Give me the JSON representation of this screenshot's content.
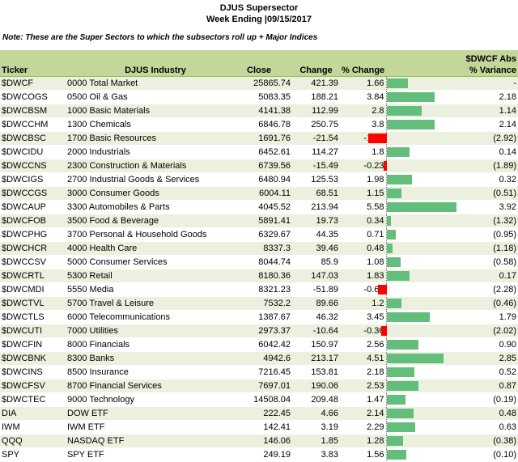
{
  "title": "DJUS Supersector",
  "subtitle": "Week Ending |09/15/2017",
  "note": "Note:  These are the Super Sectors to which the subsectors roll up + Major Indices",
  "headers": {
    "ticker": "Ticker",
    "industry": "DJUS Industry",
    "close": "Close",
    "change": "Change",
    "pct_change": "% Change",
    "abs_line1": "$DWCF Abs",
    "abs_line2": "% Variance"
  },
  "colors": {
    "positive_bar": "#63be7b",
    "negative_bar": "#ff0000",
    "header_bg": "#c4d79b",
    "band_bg": "#ebf1de"
  },
  "bar_scale_max": 5.58,
  "rows": [
    {
      "ticker": "$DWCF",
      "industry": "0000 Total Market",
      "close": "25865.74",
      "change": "421.39",
      "pct": "1.66",
      "pct_val": 1.66,
      "var": "-"
    },
    {
      "ticker": "$DWCOGS",
      "industry": "0500 Oil & Gas",
      "close": "5083.35",
      "change": "188.21",
      "pct": "3.84",
      "pct_val": 3.84,
      "var": "2.18"
    },
    {
      "ticker": "$DWCBSM",
      "industry": "1000 Basic Materials",
      "close": "4141.38",
      "change": "112.99",
      "pct": "2.8",
      "pct_val": 2.8,
      "var": "1.14"
    },
    {
      "ticker": "$DWCCHM",
      "industry": "1300 Chemicals",
      "close": "6846.78",
      "change": "250.75",
      "pct": "3.8",
      "pct_val": 3.8,
      "var": "2.14"
    },
    {
      "ticker": "$DWCBSC",
      "industry": "1700 Basic Resources",
      "close": "1691.76",
      "change": "-21.54",
      "pct": "-1.26",
      "pct_val": -1.26,
      "var": "(2.92)"
    },
    {
      "ticker": "$DWCIDU",
      "industry": "2000 Industrials",
      "close": "6452.61",
      "change": "114.27",
      "pct": "1.8",
      "pct_val": 1.8,
      "var": "0.14"
    },
    {
      "ticker": "$DWCCNS",
      "industry": "2300 Construction & Materials",
      "close": "6739.56",
      "change": "-15.49",
      "pct": "-0.23",
      "pct_val": -0.23,
      "var": "(1.89)"
    },
    {
      "ticker": "$DWCIGS",
      "industry": "2700 Industrial Goods & Services",
      "close": "6480.94",
      "change": "125.53",
      "pct": "1.98",
      "pct_val": 1.98,
      "var": "0.32"
    },
    {
      "ticker": "$DWCCGS",
      "industry": "3000 Consumer Goods",
      "close": "6004.11",
      "change": "68.51",
      "pct": "1.15",
      "pct_val": 1.15,
      "var": "(0.51)"
    },
    {
      "ticker": "$DWCAUP",
      "industry": "3300 Automobiles & Parts",
      "close": "4045.52",
      "change": "213.94",
      "pct": "5.58",
      "pct_val": 5.58,
      "var": "3.92"
    },
    {
      "ticker": "$DWCFOB",
      "industry": "3500 Food & Beverage",
      "close": "5891.41",
      "change": "19.73",
      "pct": "0.34",
      "pct_val": 0.34,
      "var": "(1.32)"
    },
    {
      "ticker": "$DWCPHG",
      "industry": "3700 Personal & Household Goods",
      "close": "6329.67",
      "change": "44.35",
      "pct": "0.71",
      "pct_val": 0.71,
      "var": "(0.95)"
    },
    {
      "ticker": "$DWCHCR",
      "industry": "4000 Health Care",
      "close": "8337.3",
      "change": "39.46",
      "pct": "0.48",
      "pct_val": 0.48,
      "var": "(1.18)"
    },
    {
      "ticker": "$DWCCSV",
      "industry": "5000 Consumer Services",
      "close": "8044.74",
      "change": "85.9",
      "pct": "1.08",
      "pct_val": 1.08,
      "var": "(0.58)"
    },
    {
      "ticker": "$DWCRTL",
      "industry": "5300 Retail",
      "close": "8180.36",
      "change": "147.03",
      "pct": "1.83",
      "pct_val": 1.83,
      "var": "0.17"
    },
    {
      "ticker": "$DWCMDI",
      "industry": "5550 Media",
      "close": "8321.23",
      "change": "-51.89",
      "pct": "-0.62",
      "pct_val": -0.62,
      "var": "(2.28)"
    },
    {
      "ticker": "$DWCTVL",
      "industry": "5700 Travel & Leisure",
      "close": "7532.2",
      "change": "89.66",
      "pct": "1.2",
      "pct_val": 1.2,
      "var": "(0.46)"
    },
    {
      "ticker": "$DWCTLS",
      "industry": "6000 Telecommunications",
      "close": "1387.67",
      "change": "46.32",
      "pct": "3.45",
      "pct_val": 3.45,
      "var": "1.79"
    },
    {
      "ticker": "$DWCUTI",
      "industry": "7000 Utilities",
      "close": "2973.37",
      "change": "-10.64",
      "pct": "-0.36",
      "pct_val": -0.36,
      "var": "(2.02)"
    },
    {
      "ticker": "$DWCFIN",
      "industry": "8000 Financials",
      "close": "6042.42",
      "change": "150.97",
      "pct": "2.56",
      "pct_val": 2.56,
      "var": "0.90"
    },
    {
      "ticker": "$DWCBNK",
      "industry": "8300 Banks",
      "close": "4942.6",
      "change": "213.17",
      "pct": "4.51",
      "pct_val": 4.51,
      "var": "2.85"
    },
    {
      "ticker": "$DWCINS",
      "industry": "8500 Insurance",
      "close": "7216.45",
      "change": "153.81",
      "pct": "2.18",
      "pct_val": 2.18,
      "var": "0.52"
    },
    {
      "ticker": "$DWCFSV",
      "industry": "8700 Financial Services",
      "close": "7697.01",
      "change": "190.06",
      "pct": "2.53",
      "pct_val": 2.53,
      "var": "0.87"
    },
    {
      "ticker": "$DWCTEC",
      "industry": "9000 Technology",
      "close": "14508.04",
      "change": "209.48",
      "pct": "1.47",
      "pct_val": 1.47,
      "var": "(0.19)"
    },
    {
      "ticker": "DIA",
      "industry": "DOW ETF",
      "close": "222.45",
      "change": "4.66",
      "pct": "2.14",
      "pct_val": 2.14,
      "var": "0.48"
    },
    {
      "ticker": "IWM",
      "industry": "IWM ETF",
      "close": "142.41",
      "change": "3.19",
      "pct": "2.29",
      "pct_val": 2.29,
      "var": "0.63"
    },
    {
      "ticker": "QQQ",
      "industry": "NASDAQ ETF",
      "close": "146.06",
      "change": "1.85",
      "pct": "1.28",
      "pct_val": 1.28,
      "var": "(0.38)"
    },
    {
      "ticker": "SPY",
      "industry": "SPY ETF",
      "close": "249.19",
      "change": "3.83",
      "pct": "1.56",
      "pct_val": 1.56,
      "var": "(0.10)"
    }
  ]
}
